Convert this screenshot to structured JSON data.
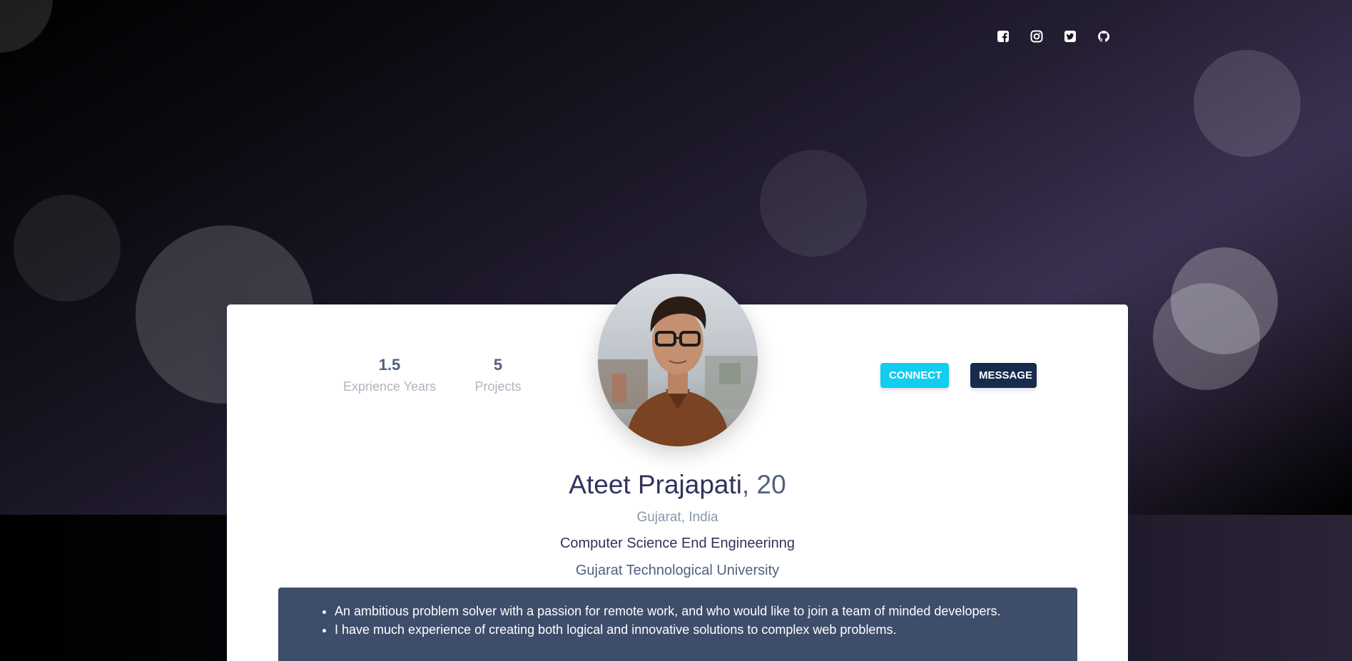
{
  "social": {
    "items": [
      {
        "icon": "facebook-icon"
      },
      {
        "icon": "instagram-icon"
      },
      {
        "icon": "twitter-icon"
      },
      {
        "icon": "github-icon"
      }
    ]
  },
  "profile": {
    "stats": [
      {
        "value": "1.5",
        "label": "Exprience Years"
      },
      {
        "value": "5",
        "label": "Projects"
      }
    ],
    "name": "Ateet Prajapati",
    "age": ", 20",
    "location": "Gujarat, India",
    "degree": "Computer Science End Engineerinng",
    "university": "Gujarat Technological University"
  },
  "actions": {
    "connect_label": "CONNECT",
    "message_label": "MESSAGE"
  },
  "about": {
    "points": [
      "An ambitious problem solver with a passion for remote work, and who would like to join a team of minded developers.",
      "I have much experience of creating both logical and innovative solutions to complex web problems."
    ]
  },
  "colors": {
    "connect": "#11cdef",
    "message": "#172b4d",
    "about_bg": "#3d4d6a"
  }
}
